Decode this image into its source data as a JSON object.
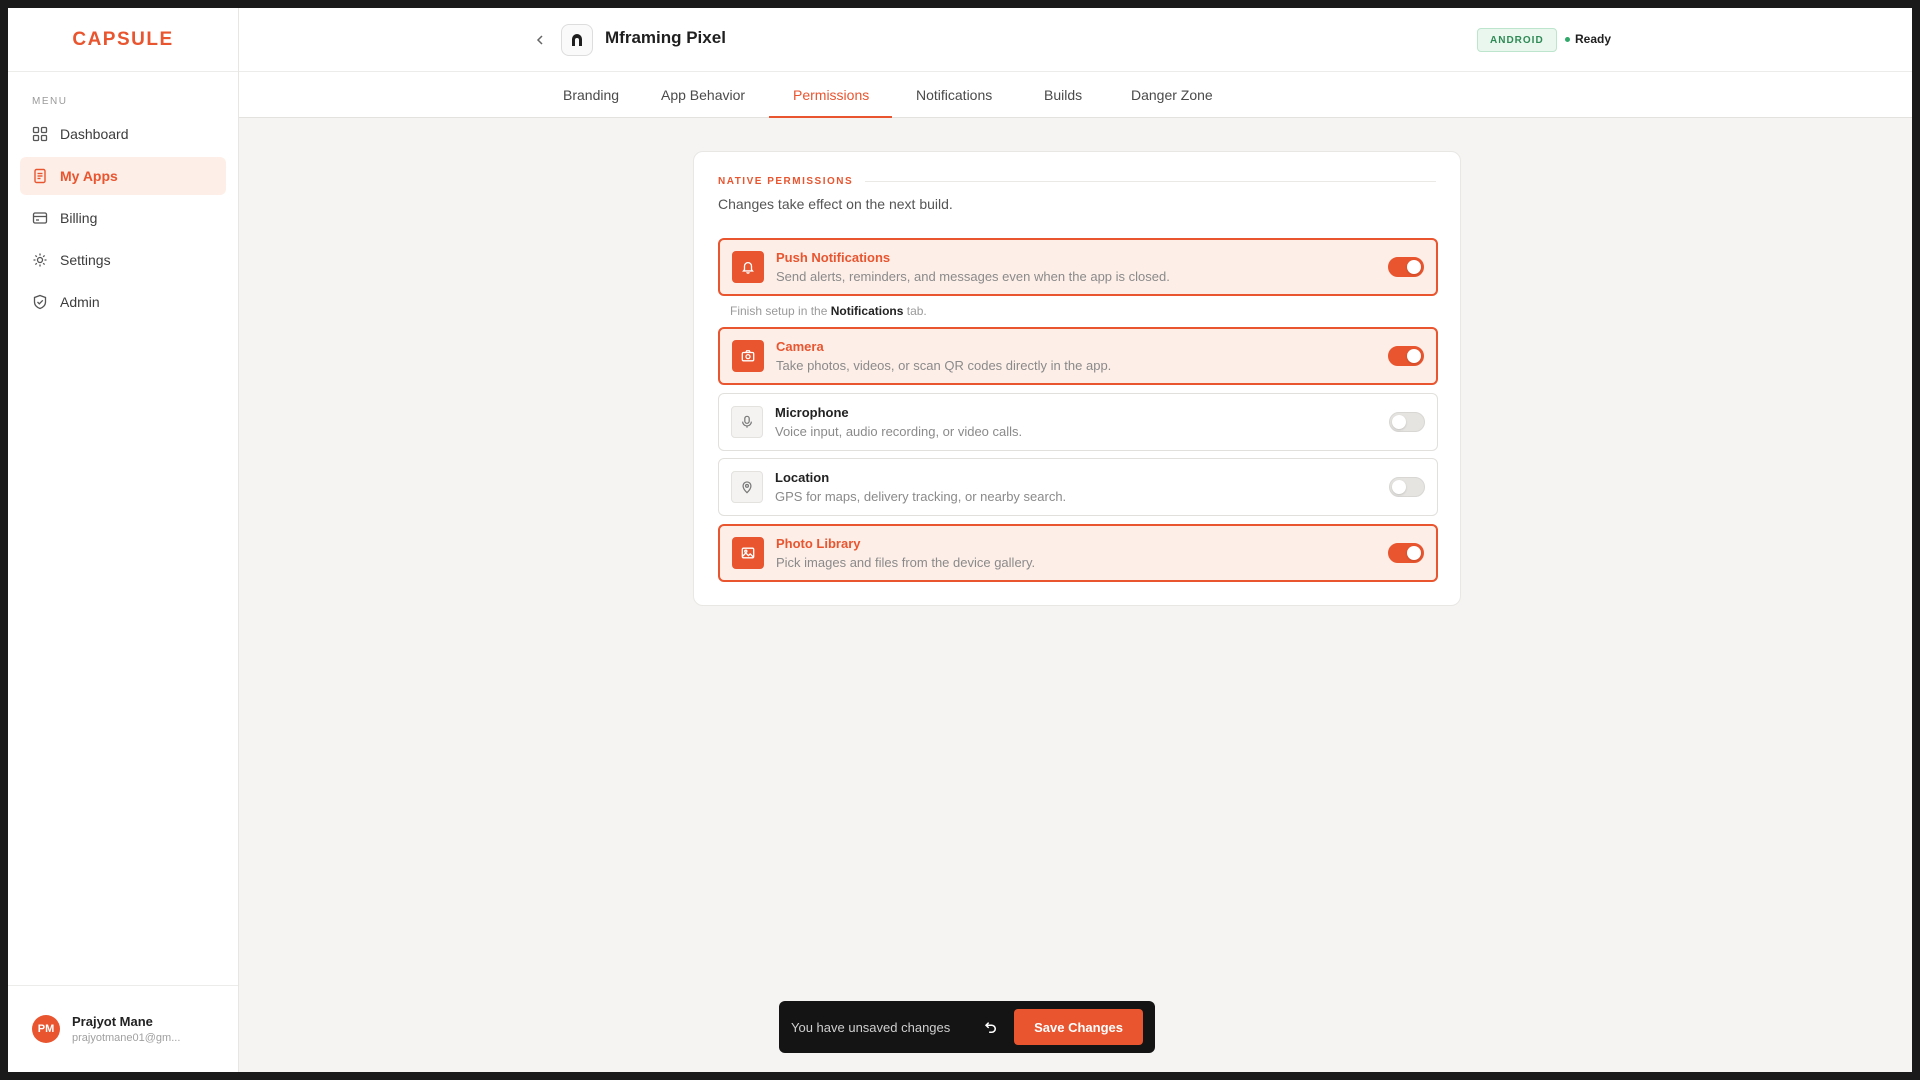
{
  "brand": {
    "logo": "CAPSULE"
  },
  "sidebar": {
    "menu_label": "MENU",
    "items": [
      {
        "label": "Dashboard",
        "icon": "grid-icon",
        "active": false
      },
      {
        "label": "My Apps",
        "icon": "document-icon",
        "active": true
      },
      {
        "label": "Billing",
        "icon": "credit-card-icon",
        "active": false
      },
      {
        "label": "Settings",
        "icon": "gear-icon",
        "active": false
      },
      {
        "label": "Admin",
        "icon": "shield-icon",
        "active": false
      }
    ],
    "user": {
      "initials": "PM",
      "name": "Prajyot Mane",
      "email": "prajyotmane01@gm..."
    }
  },
  "header": {
    "app_name": "Mframing Pixel",
    "platform": "ANDROID",
    "status": "Ready"
  },
  "tabs": [
    {
      "label": "Branding"
    },
    {
      "label": "App Behavior"
    },
    {
      "label": "Permissions",
      "active": true
    },
    {
      "label": "Notifications"
    },
    {
      "label": "Builds"
    },
    {
      "label": "Danger Zone"
    }
  ],
  "permissions_section": {
    "title": "NATIVE PERMISSIONS",
    "description": "Changes take effect on the next build.",
    "hint": {
      "prefix": "Finish setup in the",
      "link": "Notifications",
      "suffix": "tab."
    },
    "items": [
      {
        "title": "Push Notifications",
        "description": "Send alerts, reminders, and messages even when the app is closed.",
        "enabled": true,
        "icon": "bell-icon"
      },
      {
        "title": "Camera",
        "description": "Take photos, videos, or scan QR codes directly in the app.",
        "enabled": true,
        "icon": "camera-icon"
      },
      {
        "title": "Microphone",
        "description": "Voice input, audio recording, or video calls.",
        "enabled": false,
        "icon": "microphone-icon"
      },
      {
        "title": "Location",
        "description": "GPS for maps, delivery tracking, or nearby search.",
        "enabled": false,
        "icon": "map-pin-icon"
      },
      {
        "title": "Photo Library",
        "description": "Pick images and files from the device gallery.",
        "enabled": true,
        "icon": "image-icon"
      }
    ]
  },
  "unsaved_bar": {
    "message": "You have unsaved changes",
    "save_label": "Save Changes"
  },
  "colors": {
    "accent": "#e8552f",
    "accent_soft": "#fdeee8",
    "success": "#2fa86a"
  }
}
